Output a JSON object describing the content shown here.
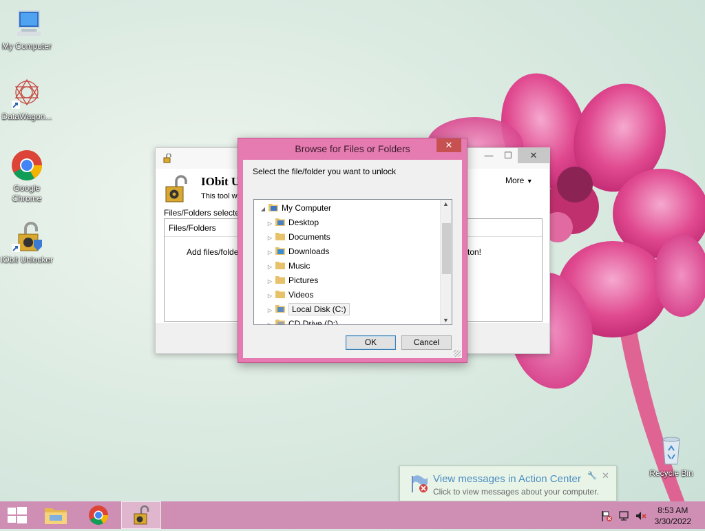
{
  "desktop": {
    "icons": [
      {
        "label": "My Computer",
        "icon": "computer-icon"
      },
      {
        "label": "DataWagon...",
        "icon": "datawagon-icon"
      },
      {
        "label": "Google Chrome",
        "icon": "chrome-icon"
      },
      {
        "label": "IObit Unlocker",
        "icon": "unlocker-icon"
      },
      {
        "label": "Recycle Bin",
        "icon": "recycle-bin-icon"
      }
    ]
  },
  "unlocker_window": {
    "app_name": "IObit U",
    "subtitle": "This tool wi",
    "more_label": "More",
    "files_selected_label": "Files/Folders selected",
    "column_header": "Files/Folders",
    "hint_left": "Add files/folders",
    "hint_right": "ton!",
    "min_symbol": "—",
    "max_symbol": "☐",
    "close_symbol": "✕"
  },
  "browse_dialog": {
    "title": "Browse for Files or Folders",
    "prompt": "Select the file/folder you want to unlock",
    "close_symbol": "✕",
    "tree": [
      {
        "label": "My Computer",
        "level": 0,
        "expanded": true,
        "icon": "computer-icon"
      },
      {
        "label": "Desktop",
        "level": 1,
        "icon": "desktop-folder-icon"
      },
      {
        "label": "Documents",
        "level": 1,
        "icon": "documents-folder-icon"
      },
      {
        "label": "Downloads",
        "level": 1,
        "icon": "downloads-folder-icon"
      },
      {
        "label": "Music",
        "level": 1,
        "icon": "music-folder-icon"
      },
      {
        "label": "Pictures",
        "level": 1,
        "icon": "pictures-folder-icon"
      },
      {
        "label": "Videos",
        "level": 1,
        "icon": "videos-folder-icon"
      },
      {
        "label": "Local Disk (C:)",
        "level": 1,
        "icon": "local-disk-icon",
        "selected": true
      },
      {
        "label": "CD Drive (D:)",
        "level": 1,
        "icon": "cd-drive-icon"
      }
    ],
    "ok_label": "OK",
    "cancel_label": "Cancel"
  },
  "toast": {
    "title": "View messages in Action Center",
    "body": "Click to view messages about your computer."
  },
  "taskbar": {
    "time": "8:53 AM",
    "date": "3/30/2022",
    "pinned": [
      "start-icon",
      "file-explorer-icon",
      "chrome-icon",
      "unlocker-icon"
    ]
  },
  "colors": {
    "accent": "#e57bb0",
    "taskbar": "#cf8fb5",
    "close_red": "#c75050"
  }
}
